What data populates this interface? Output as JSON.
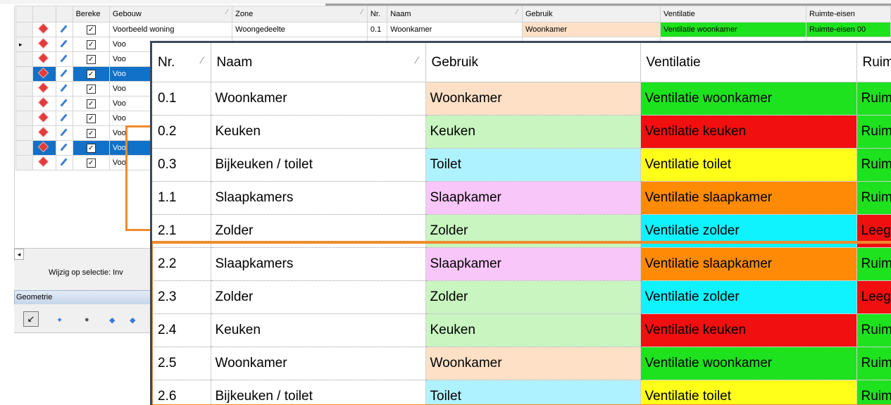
{
  "background": {
    "columns": [
      "Bereke",
      "Gebouw",
      "Zone",
      "Nr.",
      "Naam",
      "Gebruik",
      "Ventilatie",
      "Ruimte-eisen"
    ],
    "first_row": {
      "gebouw": "Voorbeeld woning",
      "zone": "Woongedeelte",
      "nr": "0.1",
      "naam": "Woonkamer",
      "gebruik": "Woonkamer",
      "ventilatie": "Ventilatie woonkamer",
      "ruimte": "Ruimte-eisen 00"
    },
    "truncated_gebouw": "Voo",
    "row_count": 10,
    "selected_rows": [
      3,
      8
    ],
    "checkbox_glyph": "✓",
    "wijzig_label": "Wijzig op selectie:",
    "wijzig_value": "Inv",
    "geometrie_label": "Geometrie",
    "scroll_arrow": "◂",
    "current_row_marker": "▸",
    "tool_arrow_glyph": "↙",
    "tool_glyphs": [
      "✦",
      "●",
      "◆",
      "◆"
    ]
  },
  "zoom": {
    "headers": {
      "nr": "Nr.",
      "naam": "Naam",
      "gebruik": "Gebruik",
      "ventilatie": "Ventilatie",
      "ruimte": "Ruim"
    },
    "sort_glyph": "⁄",
    "rows": [
      {
        "nr": "0.1",
        "naam": "Woonkamer",
        "gebruik": "Woonkamer",
        "gebruik_color": "#fde0c6",
        "ventilatie": "Ventilatie woonkamer",
        "vent_color": "#1ee21e",
        "ruimte": "Ruim",
        "ruimte_color": "#1ee21e"
      },
      {
        "nr": "0.2",
        "naam": "Keuken",
        "gebruik": "Keuken",
        "gebruik_color": "#c8f5c0",
        "ventilatie": "Ventilatie keuken",
        "vent_color": "#f10f0f",
        "ruimte": "Ruim",
        "ruimte_color": "#1ee21e"
      },
      {
        "nr": "0.3",
        "naam": "Bijkeuken / toilet",
        "gebruik": "Toilet",
        "gebruik_color": "#aff2ff",
        "ventilatie": "Ventilatie toilet",
        "vent_color": "#ffff1a",
        "ruimte": "Ruim",
        "ruimte_color": "#1ee21e"
      },
      {
        "nr": "1.1",
        "naam": "Slaapkamers",
        "gebruik": "Slaapkamer",
        "gebruik_color": "#f9c6f9",
        "ventilatie": "Ventilatie slaapkamer",
        "vent_color": "#ff8a05",
        "ruimte": "Ruim",
        "ruimte_color": "#1ee21e"
      },
      {
        "nr": "2.1",
        "naam": "Zolder",
        "gebruik": "Zolder",
        "gebruik_color": "#c8f5c0",
        "ventilatie": "Ventilatie zolder",
        "vent_color": "#0ff2ff",
        "ruimte": "Leeg",
        "ruimte_color": "#f10f0f"
      },
      {
        "nr": "2.2",
        "naam": "Slaapkamers",
        "gebruik": "Slaapkamer",
        "gebruik_color": "#f9c6f9",
        "ventilatie": "Ventilatie slaapkamer",
        "vent_color": "#ff8a05",
        "ruimte": "Ruim",
        "ruimte_color": "#1ee21e"
      },
      {
        "nr": "2.3",
        "naam": "Zolder",
        "gebruik": "Zolder",
        "gebruik_color": "#c8f5c0",
        "ventilatie": "Ventilatie zolder",
        "vent_color": "#0ff2ff",
        "ruimte": "Leeg",
        "ruimte_color": "#f10f0f"
      },
      {
        "nr": "2.4",
        "naam": "Keuken",
        "gebruik": "Keuken",
        "gebruik_color": "#c8f5c0",
        "ventilatie": "Ventilatie keuken",
        "vent_color": "#f10f0f",
        "ruimte": "Ruim",
        "ruimte_color": "#1ee21e"
      },
      {
        "nr": "2.5",
        "naam": "Woonkamer",
        "gebruik": "Woonkamer",
        "gebruik_color": "#fde0c6",
        "ventilatie": "Ventilatie woonkamer",
        "vent_color": "#1ee21e",
        "ruimte": "Ruim",
        "ruimte_color": "#1ee21e"
      },
      {
        "nr": "2.6",
        "naam": "Bijkeuken / toilet",
        "gebruik": "Toilet",
        "gebruik_color": "#aff2ff",
        "ventilatie": "Ventilatie toilet",
        "vent_color": "#ffff1a",
        "ruimte": "Ruim",
        "ruimte_color": "#1ee21e"
      }
    ]
  }
}
